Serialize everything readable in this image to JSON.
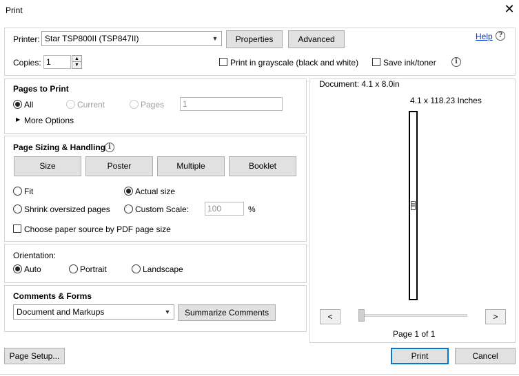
{
  "window": {
    "title": "Print",
    "close_glyph": "✕"
  },
  "printer": {
    "label": "Printer:",
    "selected": "Star TSP800II (TSP847II)",
    "properties_label": "Properties",
    "advanced_label": "Advanced",
    "help_label": "Help"
  },
  "copies": {
    "label": "Copies:",
    "value": "1"
  },
  "options": {
    "grayscale_label": "Print in grayscale (black and white)",
    "grayscale_checked": false,
    "save_ink_label": "Save ink/toner",
    "save_ink_checked": false
  },
  "pages_to_print": {
    "heading": "Pages to Print",
    "all_label": "All",
    "current_label": "Current",
    "pages_label": "Pages",
    "pages_value": "1",
    "selected": "All",
    "more_options_label": "More Options"
  },
  "page_sizing": {
    "heading": "Page Sizing & Handling",
    "tabs": [
      "Size",
      "Poster",
      "Multiple",
      "Booklet"
    ],
    "fit_label": "Fit",
    "actual_size_label": "Actual size",
    "shrink_label": "Shrink oversized pages",
    "custom_scale_label": "Custom Scale:",
    "custom_scale_value": "100",
    "percent_label": "%",
    "paper_source_label": "Choose paper source by PDF page size",
    "selected": "Actual size"
  },
  "orientation": {
    "heading": "Orientation:",
    "auto_label": "Auto",
    "portrait_label": "Portrait",
    "landscape_label": "Landscape",
    "selected": "Auto"
  },
  "comments_forms": {
    "heading": "Comments & Forms",
    "selected": "Document and Markups",
    "summarize_label": "Summarize Comments"
  },
  "preview": {
    "document_size": "Document: 4.1 x 8.0in",
    "paper_size": "4.1 x 118.23 Inches",
    "prev_label": "<",
    "next_label": ">",
    "page_indicator": "Page 1 of 1",
    "slider_position": 0
  },
  "footer": {
    "page_setup_label": "Page Setup...",
    "print_label": "Print",
    "cancel_label": "Cancel"
  },
  "colors": {
    "accent": "#0078d7",
    "link": "#0033cc",
    "button_bg": "#e1e1e1",
    "panel_border": "#d4d4d4"
  }
}
